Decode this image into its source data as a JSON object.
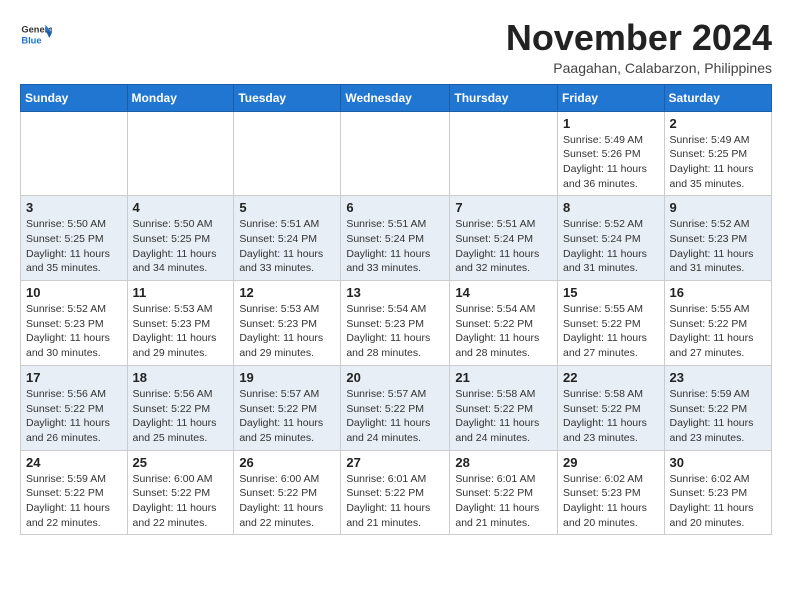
{
  "header": {
    "logo_line1": "General",
    "logo_line2": "Blue",
    "month": "November 2024",
    "location": "Paagahan, Calabarzon, Philippines"
  },
  "weekdays": [
    "Sunday",
    "Monday",
    "Tuesday",
    "Wednesday",
    "Thursday",
    "Friday",
    "Saturday"
  ],
  "weeks": [
    [
      {
        "day": "",
        "info": ""
      },
      {
        "day": "",
        "info": ""
      },
      {
        "day": "",
        "info": ""
      },
      {
        "day": "",
        "info": ""
      },
      {
        "day": "",
        "info": ""
      },
      {
        "day": "1",
        "info": "Sunrise: 5:49 AM\nSunset: 5:26 PM\nDaylight: 11 hours and 36 minutes."
      },
      {
        "day": "2",
        "info": "Sunrise: 5:49 AM\nSunset: 5:25 PM\nDaylight: 11 hours and 35 minutes."
      }
    ],
    [
      {
        "day": "3",
        "info": "Sunrise: 5:50 AM\nSunset: 5:25 PM\nDaylight: 11 hours and 35 minutes."
      },
      {
        "day": "4",
        "info": "Sunrise: 5:50 AM\nSunset: 5:25 PM\nDaylight: 11 hours and 34 minutes."
      },
      {
        "day": "5",
        "info": "Sunrise: 5:51 AM\nSunset: 5:24 PM\nDaylight: 11 hours and 33 minutes."
      },
      {
        "day": "6",
        "info": "Sunrise: 5:51 AM\nSunset: 5:24 PM\nDaylight: 11 hours and 33 minutes."
      },
      {
        "day": "7",
        "info": "Sunrise: 5:51 AM\nSunset: 5:24 PM\nDaylight: 11 hours and 32 minutes."
      },
      {
        "day": "8",
        "info": "Sunrise: 5:52 AM\nSunset: 5:24 PM\nDaylight: 11 hours and 31 minutes."
      },
      {
        "day": "9",
        "info": "Sunrise: 5:52 AM\nSunset: 5:23 PM\nDaylight: 11 hours and 31 minutes."
      }
    ],
    [
      {
        "day": "10",
        "info": "Sunrise: 5:52 AM\nSunset: 5:23 PM\nDaylight: 11 hours and 30 minutes."
      },
      {
        "day": "11",
        "info": "Sunrise: 5:53 AM\nSunset: 5:23 PM\nDaylight: 11 hours and 29 minutes."
      },
      {
        "day": "12",
        "info": "Sunrise: 5:53 AM\nSunset: 5:23 PM\nDaylight: 11 hours and 29 minutes."
      },
      {
        "day": "13",
        "info": "Sunrise: 5:54 AM\nSunset: 5:23 PM\nDaylight: 11 hours and 28 minutes."
      },
      {
        "day": "14",
        "info": "Sunrise: 5:54 AM\nSunset: 5:22 PM\nDaylight: 11 hours and 28 minutes."
      },
      {
        "day": "15",
        "info": "Sunrise: 5:55 AM\nSunset: 5:22 PM\nDaylight: 11 hours and 27 minutes."
      },
      {
        "day": "16",
        "info": "Sunrise: 5:55 AM\nSunset: 5:22 PM\nDaylight: 11 hours and 27 minutes."
      }
    ],
    [
      {
        "day": "17",
        "info": "Sunrise: 5:56 AM\nSunset: 5:22 PM\nDaylight: 11 hours and 26 minutes."
      },
      {
        "day": "18",
        "info": "Sunrise: 5:56 AM\nSunset: 5:22 PM\nDaylight: 11 hours and 25 minutes."
      },
      {
        "day": "19",
        "info": "Sunrise: 5:57 AM\nSunset: 5:22 PM\nDaylight: 11 hours and 25 minutes."
      },
      {
        "day": "20",
        "info": "Sunrise: 5:57 AM\nSunset: 5:22 PM\nDaylight: 11 hours and 24 minutes."
      },
      {
        "day": "21",
        "info": "Sunrise: 5:58 AM\nSunset: 5:22 PM\nDaylight: 11 hours and 24 minutes."
      },
      {
        "day": "22",
        "info": "Sunrise: 5:58 AM\nSunset: 5:22 PM\nDaylight: 11 hours and 23 minutes."
      },
      {
        "day": "23",
        "info": "Sunrise: 5:59 AM\nSunset: 5:22 PM\nDaylight: 11 hours and 23 minutes."
      }
    ],
    [
      {
        "day": "24",
        "info": "Sunrise: 5:59 AM\nSunset: 5:22 PM\nDaylight: 11 hours and 22 minutes."
      },
      {
        "day": "25",
        "info": "Sunrise: 6:00 AM\nSunset: 5:22 PM\nDaylight: 11 hours and 22 minutes."
      },
      {
        "day": "26",
        "info": "Sunrise: 6:00 AM\nSunset: 5:22 PM\nDaylight: 11 hours and 22 minutes."
      },
      {
        "day": "27",
        "info": "Sunrise: 6:01 AM\nSunset: 5:22 PM\nDaylight: 11 hours and 21 minutes."
      },
      {
        "day": "28",
        "info": "Sunrise: 6:01 AM\nSunset: 5:22 PM\nDaylight: 11 hours and 21 minutes."
      },
      {
        "day": "29",
        "info": "Sunrise: 6:02 AM\nSunset: 5:23 PM\nDaylight: 11 hours and 20 minutes."
      },
      {
        "day": "30",
        "info": "Sunrise: 6:02 AM\nSunset: 5:23 PM\nDaylight: 11 hours and 20 minutes."
      }
    ]
  ]
}
